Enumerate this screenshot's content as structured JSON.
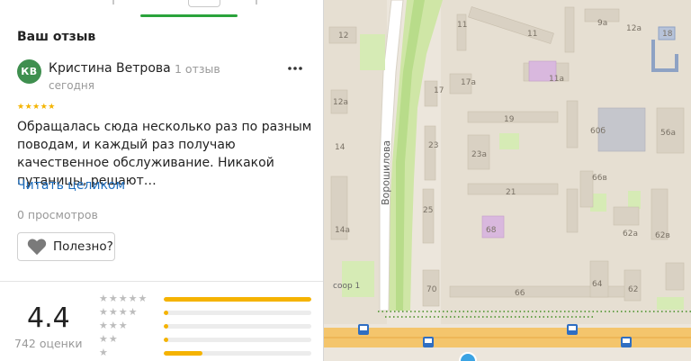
{
  "review_section": {
    "title": "Ваш отзыв",
    "author": {
      "initials": "КВ",
      "name": "Кристина Ветрова",
      "separator": "·",
      "reviews_count": "1 отзыв",
      "date": "сегодня"
    },
    "stars": "★★★★★",
    "more_icon": "more-dots-icon",
    "text": "Обращалась сюда несколько раз по разным поводам, и каждый раз получаю качественное обслуживание. Никакой путаницы, решают…",
    "read_more": "Читать целиком",
    "views": "0 просмотров",
    "useful_button": {
      "icon": "heart-icon",
      "label": "Полезно?"
    }
  },
  "rating_summary": {
    "value": "4.4",
    "count_label": "742 оценки",
    "distribution": [
      {
        "stars": "★★★★★",
        "fraction": 1.0
      },
      {
        "stars": "★★★★",
        "fraction": 0.03
      },
      {
        "stars": "★★★",
        "fraction": 0.03
      },
      {
        "stars": "★★",
        "fraction": 0.03
      },
      {
        "stars": "★",
        "fraction": 0.26
      }
    ]
  },
  "map": {
    "street_label": "Ворошилова",
    "street_label_2": "соор 1",
    "buildings": [
      "12",
      "11",
      "9а",
      "12а",
      "18",
      "17а",
      "17",
      "11а",
      "12а",
      "19",
      "60б",
      "56а",
      "23",
      "23а",
      "66в",
      "21",
      "25",
      "68",
      "62а",
      "62в",
      "14а",
      "66",
      "70",
      "64",
      "62",
      "14"
    ]
  },
  "colors": {
    "accent_green": "#2aa33b",
    "link_blue": "#1f6fbf",
    "star_yellow": "#f4b400",
    "bar_yellow": "#f5b301",
    "avatar_green": "#3f8f4f"
  }
}
